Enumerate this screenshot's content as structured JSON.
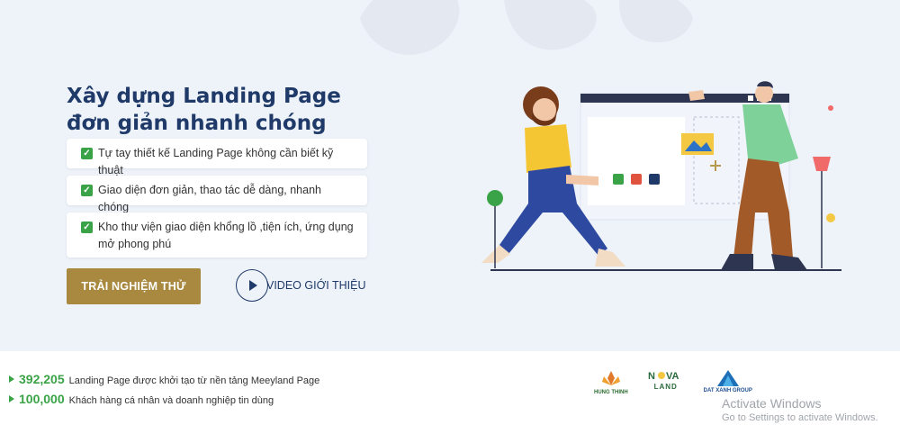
{
  "hero": {
    "title": "Xây dựng Landing Page đơn giản nhanh chóng tiện lợi",
    "features": [
      "Tự tay thiết kế Landing Page không cần biết kỹ thuật",
      "Giao diện đơn giản, thao tác dễ dàng, nhanh chóng",
      "Kho thư viện giao diện khổng lồ ,tiện ích, ứng dụng mở phong phú"
    ],
    "cta_label": "TRẢI NGHIỆM THỬ",
    "video_label": "VIDEO GIỚI THIỆU",
    "accent_color": "#a8893f",
    "title_color": "#1f3a68"
  },
  "stats": [
    {
      "number": "392,205",
      "text": "Landing Page được khởi tạo từ nền tảng Meeyland Page"
    },
    {
      "number": "100,000",
      "text": "Khách hàng cá nhân và doanh nghiệp tin dùng"
    }
  ],
  "partners": [
    {
      "name": "HUNG THINH",
      "icon": "lotus-logo-icon"
    },
    {
      "name": "LAND",
      "icon": "novaland-logo-icon"
    },
    {
      "name": "DAT XANH GROUP",
      "icon": "datxanh-logo-icon"
    }
  ],
  "watermark": {
    "title": "Activate Windows",
    "subtitle": "Go to Settings to activate Windows."
  }
}
